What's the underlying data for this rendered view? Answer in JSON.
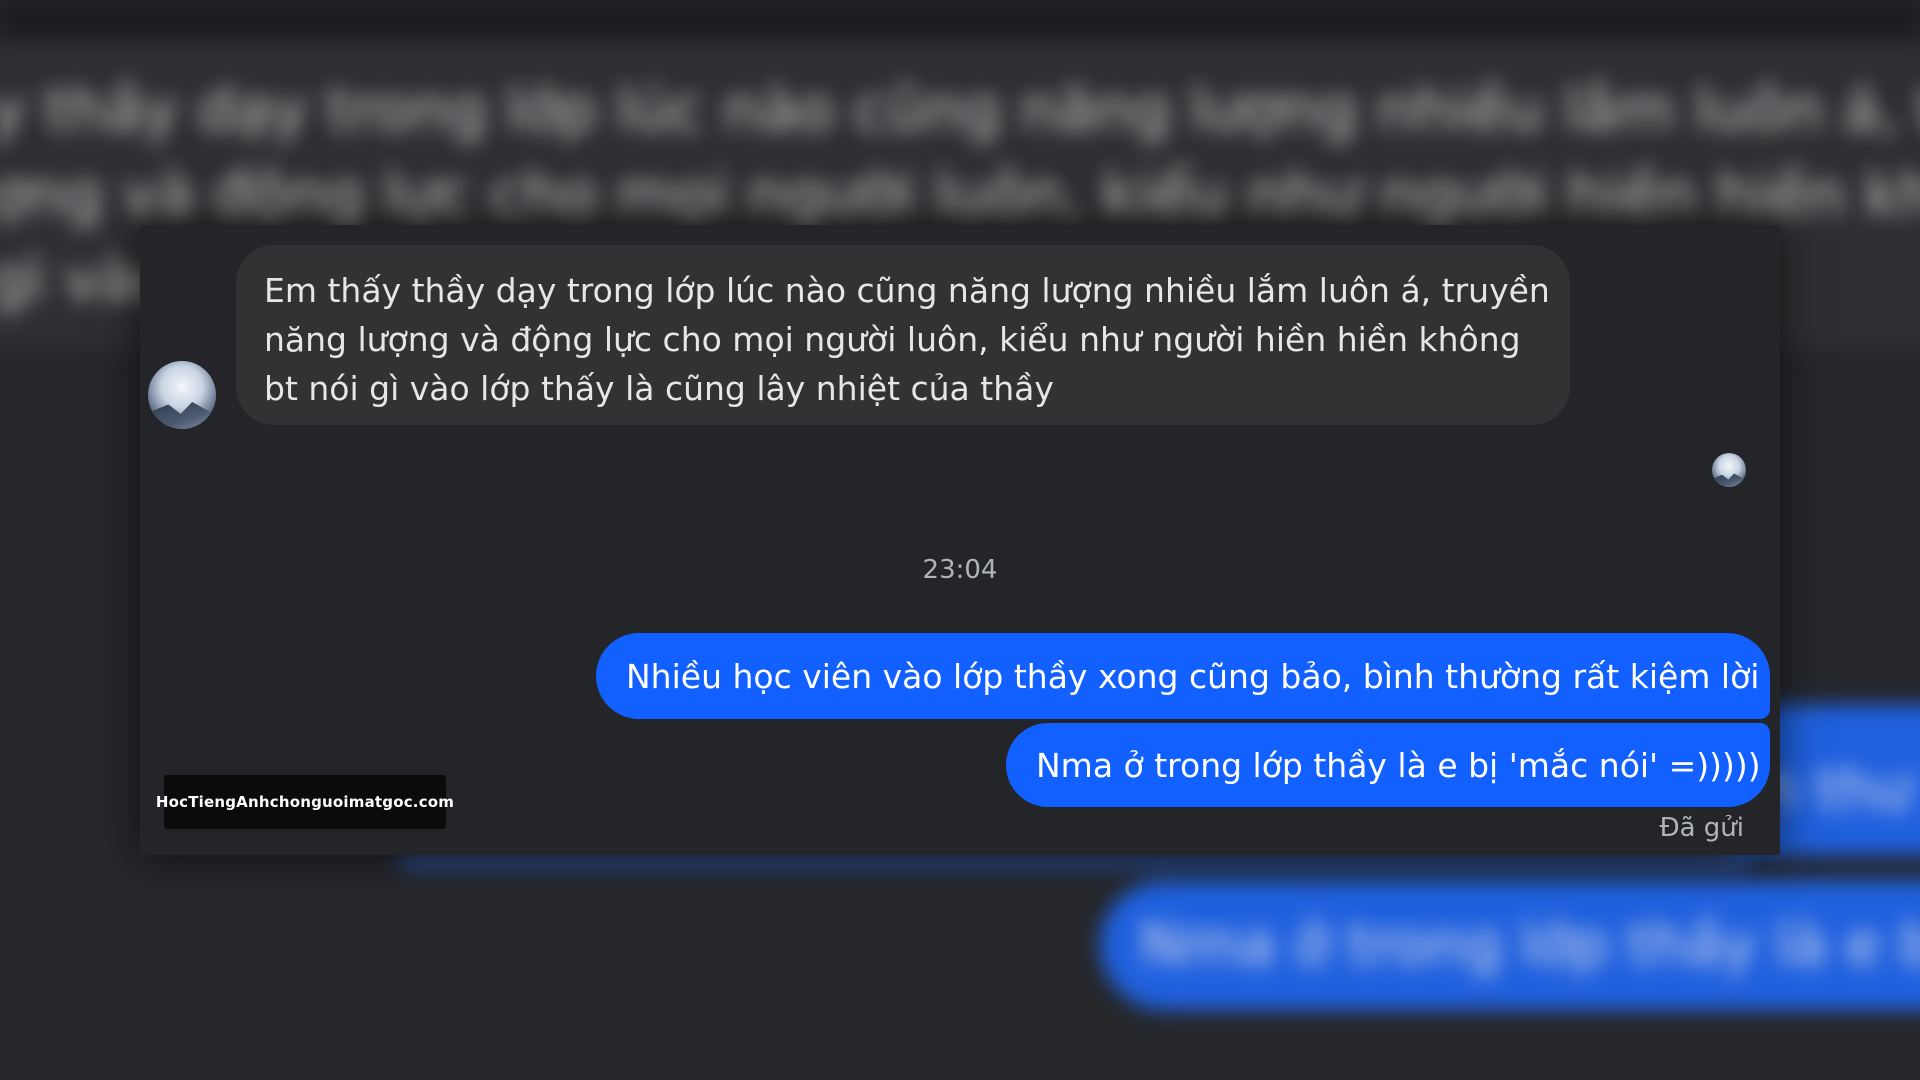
{
  "background": {
    "blurred_lines": [
      "y thầy dạy trong lớp lúc nào cũng năng lượng nhiều lắm luôn á, truyề",
      "ợng và động lực cho mọi người luôn, kiểu như người hiền hiền khôn",
      "gì vào"
    ],
    "blurred_blue_small": "h thư",
    "blurred_blue_large": "Nma ở trong lớp thầy là e b"
  },
  "chat": {
    "incoming_message": {
      "lines": [
        "Em thấy thầy dạy trong lớp lúc nào cũng năng lượng nhiều lắm luôn á, truyền",
        "năng lượng và động lực cho mọi người luôn, kiểu như người hiền hiền không",
        "bt nói gì vào lớp thấy là cũng lây nhiệt của thầy"
      ]
    },
    "timestamp": "23:04",
    "outgoing_messages": [
      "Nhiều học viên vào lớp thầy xong cũng bảo, bình thường rất kiệm lời",
      "Nma ở trong lớp thầy là e bị 'mắc nói' =)))))"
    ],
    "status": "Đã gửi"
  },
  "watermark": "HocTiengAnhchonguoimatgoc.com",
  "colors": {
    "panel_bg": "#232529",
    "incoming_bubble": "#303234",
    "outgoing_bubble": "#1160ff",
    "muted_text": "#b0b3b8"
  },
  "icons": {
    "incoming_avatar": "avatar-icon",
    "seen_indicator": "seen-avatar-icon"
  }
}
